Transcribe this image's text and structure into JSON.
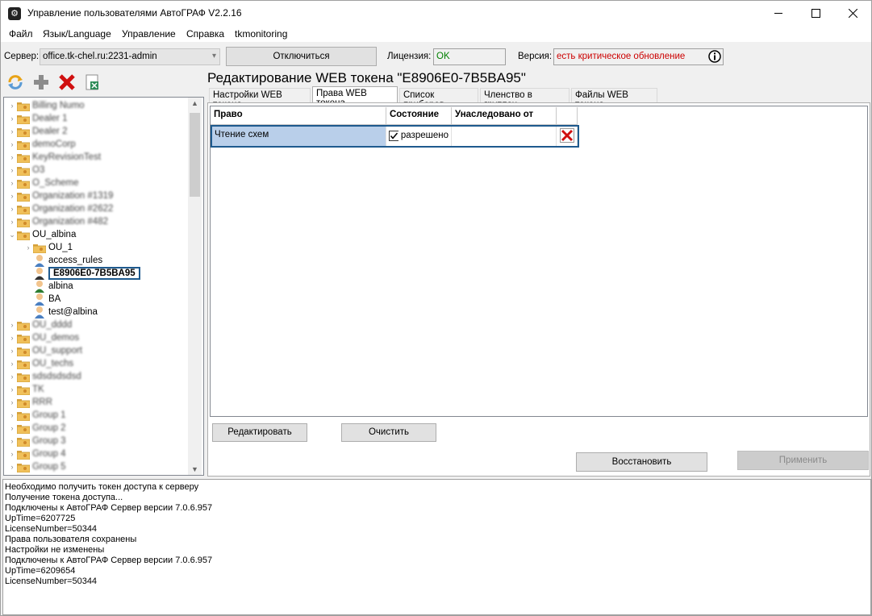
{
  "window": {
    "title": "Управление пользователями АвтоГРАФ V2.2.16"
  },
  "menu": [
    "Файл",
    "Язык/Language",
    "Управление",
    "Справка",
    "tkmonitoring"
  ],
  "server": {
    "label": "Сервер:",
    "value": "office.tk-chel.ru:2231-admin",
    "disconnect_label": "Отключиться",
    "license_label": "Лицензия:",
    "license_value": "OK",
    "version_label": "Версия:",
    "version_value": "есть критическое обновление",
    "license_color": "#008000",
    "version_color": "#cc0000"
  },
  "tree": {
    "blurred_top": [
      "Billing Numo",
      "Dealer 1",
      "Dealer 2",
      "demoCorp",
      "KeyRevisionTest",
      "O3",
      "O_Scheme",
      "Organization #1319",
      "Organization #2622",
      "Organization #482"
    ],
    "ou_albina": "OU_albina",
    "children": [
      "OU_1",
      "access_rules",
      "E8906E0-7B5BA95",
      "albina",
      "BA",
      "test@albina"
    ],
    "blurred_bottom": [
      "OU_dddd",
      "OU_demos",
      "OU_support",
      "OU_techs",
      "sdsdsdsdsd",
      "TK",
      "RRR",
      "Group 1",
      "Group 2",
      "Group 3",
      "Group 4",
      "Group 5"
    ]
  },
  "editor": {
    "heading": "Редактирование WEB токена \"E8906E0-7B5BA95\"",
    "tabs": [
      "Настройки WEB токена",
      "Права WEB токена",
      "Список приборов",
      "Членство в группах",
      "Файлы WEB токена"
    ],
    "active_tab": 1,
    "columns": [
      "Право",
      "Состояние",
      "Унаследовано от"
    ],
    "rows": [
      {
        "right": "Чтение схем",
        "state": "разрешено",
        "checked": true,
        "inherited": ""
      }
    ],
    "edit_label": "Редактировать",
    "clear_label": "Очистить",
    "restore_label": "Восстановить",
    "apply_label": "Применить"
  },
  "log": [
    "Необходимо получить токен доступа к серверу",
    "Получение токена доступа...",
    "Подключены к АвтоГРАФ Сервер версии 7.0.6.957",
    "UpTime=6207725",
    "LicenseNumber=50344",
    "Права пользователя сохранены",
    "Настройки не изменены",
    "Подключены к АвтоГРАФ Сервер версии 7.0.6.957",
    "UpTime=6209654",
    "LicenseNumber=50344"
  ]
}
